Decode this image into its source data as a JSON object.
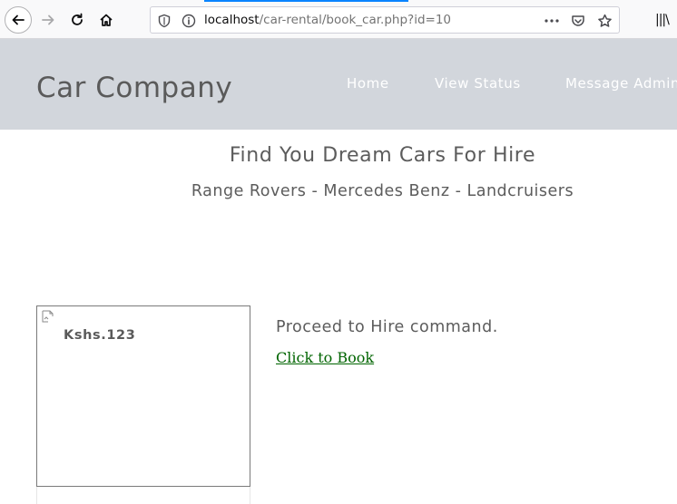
{
  "browser": {
    "url_host": "localhost",
    "url_path": "/car-rental/book_car.php?id=10",
    "back_icon": "back-arrow-icon",
    "forward_icon": "forward-arrow-icon",
    "reload_icon": "reload-icon",
    "home_icon": "home-icon",
    "library_glyph": "|||\\"
  },
  "header": {
    "brand": "Car Company",
    "nav": [
      {
        "label": "Home"
      },
      {
        "label": "View Status"
      },
      {
        "label": "Message Admin"
      }
    ],
    "background": "#d2d6dc"
  },
  "hero": {
    "title": "Find You Dream Cars For Hire",
    "subtitle": "Range Rovers - Mercedes Benz - Landcruisers"
  },
  "car": {
    "price": "Kshs.123",
    "image_state": "broken-image-icon"
  },
  "booking": {
    "prompt": "Proceed to Hire command.",
    "link_label": "Click to Book",
    "link_color": "#006400"
  }
}
